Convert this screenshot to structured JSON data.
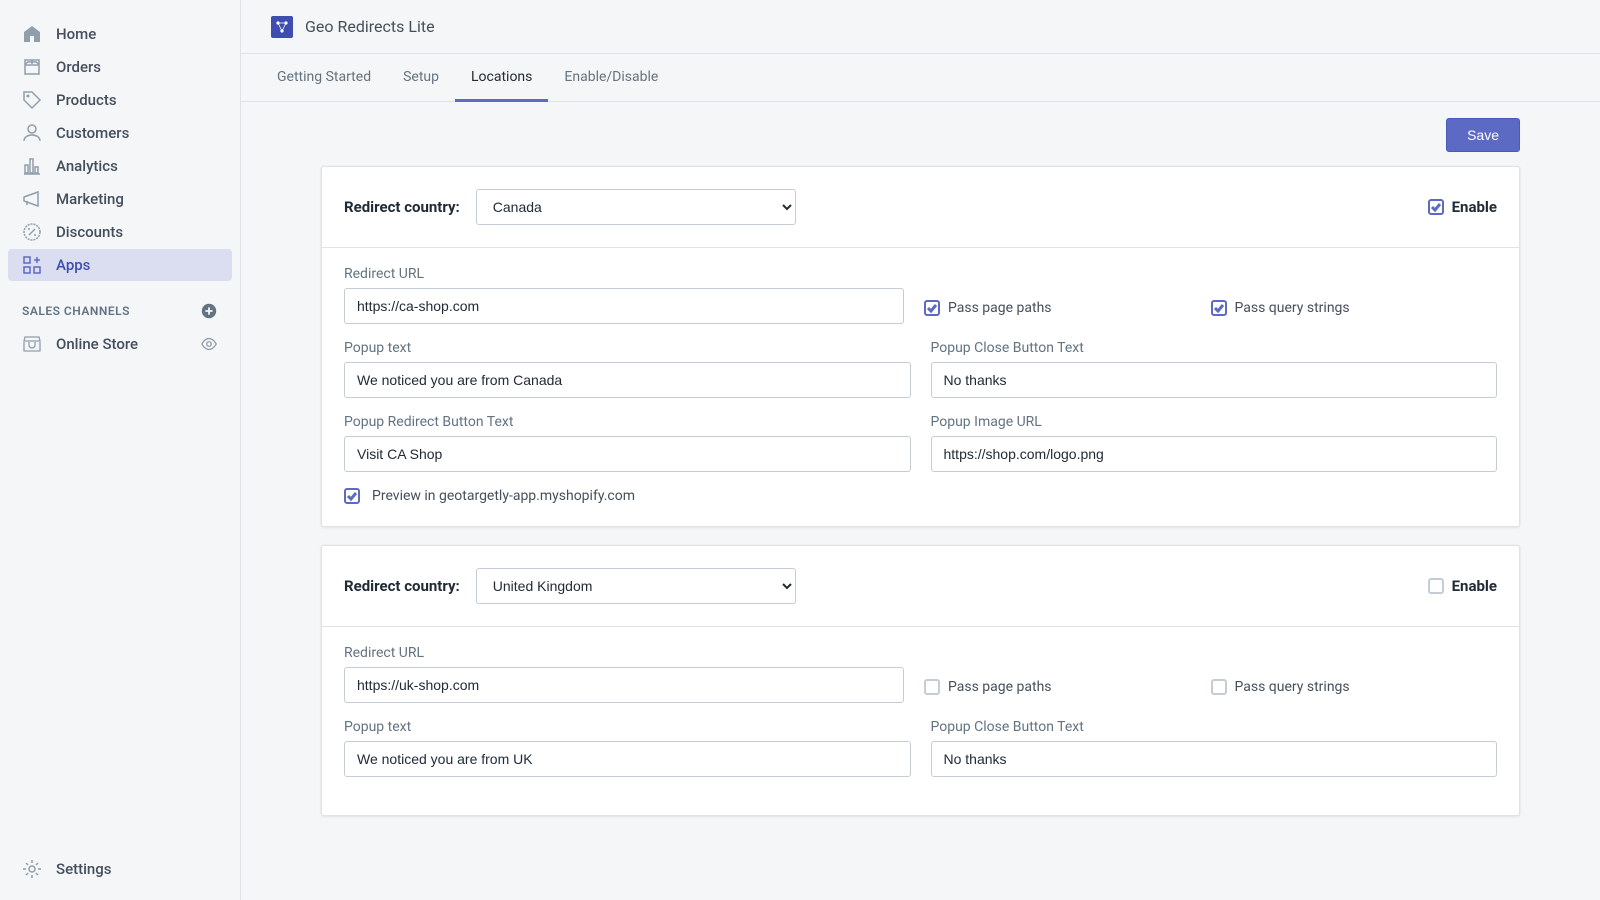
{
  "sidebar": {
    "nav": [
      {
        "key": "home",
        "label": "Home"
      },
      {
        "key": "orders",
        "label": "Orders"
      },
      {
        "key": "products",
        "label": "Products"
      },
      {
        "key": "customers",
        "label": "Customers"
      },
      {
        "key": "analytics",
        "label": "Analytics"
      },
      {
        "key": "marketing",
        "label": "Marketing"
      },
      {
        "key": "discounts",
        "label": "Discounts"
      },
      {
        "key": "apps",
        "label": "Apps"
      }
    ],
    "channels_header": "SALES CHANNELS",
    "online_store": "Online Store",
    "settings": "Settings"
  },
  "app": {
    "title": "Geo Redirects Lite"
  },
  "tabs": {
    "items": [
      {
        "key": "getting_started",
        "label": "Getting Started"
      },
      {
        "key": "setup",
        "label": "Setup"
      },
      {
        "key": "locations",
        "label": "Locations"
      },
      {
        "key": "enable_disable",
        "label": "Enable/Disable"
      }
    ],
    "active": "locations"
  },
  "save_label": "Save",
  "labels": {
    "redirect_country": "Redirect country:",
    "enable": "Enable",
    "redirect_url": "Redirect URL",
    "pass_page_paths": "Pass page paths",
    "pass_query_strings": "Pass query strings",
    "popup_text": "Popup text",
    "popup_close_btn": "Popup Close Button Text",
    "popup_redirect_btn": "Popup Redirect Button Text",
    "popup_image_url": "Popup Image URL",
    "preview_in": "Preview in geotargetly-app.myshopify.com"
  },
  "cards": [
    {
      "country": "Canada",
      "enabled": true,
      "redirect_url": "https://ca-shop.com",
      "pass_paths": true,
      "pass_query": true,
      "popup_text": "We noticed you are from Canada",
      "close_btn": "No thanks",
      "redirect_btn": "Visit CA Shop",
      "image_url": "https://shop.com/logo.png",
      "preview": true
    },
    {
      "country": "United Kingdom",
      "enabled": false,
      "redirect_url": "https://uk-shop.com",
      "pass_paths": false,
      "pass_query": false,
      "popup_text": "We noticed you are from UK",
      "close_btn": "No thanks",
      "redirect_btn": "",
      "image_url": "",
      "preview": false
    }
  ]
}
